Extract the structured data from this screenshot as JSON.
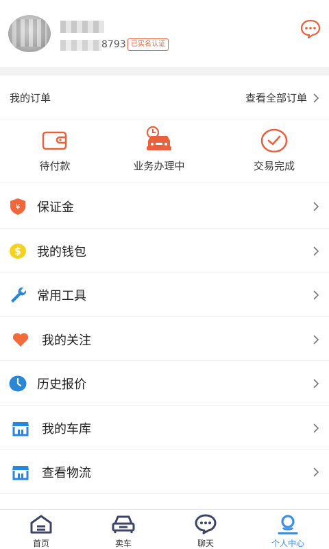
{
  "profile": {
    "phone_tail": "8793",
    "verified_badge": "已实名认证"
  },
  "orders": {
    "title": "我的订单",
    "view_all": "查看全部订单"
  },
  "order_status": [
    {
      "label": "待付款",
      "icon": "wallet-icon"
    },
    {
      "label": "业务办理中",
      "icon": "car-clock-icon"
    },
    {
      "label": "交易完成",
      "icon": "check-circle-icon"
    }
  ],
  "menu": [
    {
      "label": "保证金",
      "icon": "shield-yen-icon"
    },
    {
      "label": "我的钱包",
      "icon": "dollar-coin-icon"
    },
    {
      "label": "常用工具",
      "icon": "wrench-icon"
    },
    {
      "label": "我的关注",
      "icon": "heart-icon"
    },
    {
      "label": "历史报价",
      "icon": "clock-icon"
    },
    {
      "label": "我的车库",
      "icon": "store-icon"
    },
    {
      "label": "查看物流",
      "icon": "store-icon"
    }
  ],
  "tabs": [
    {
      "label": "首页",
      "icon": "home-icon",
      "active": false
    },
    {
      "label": "卖车",
      "icon": "car-icon",
      "active": false
    },
    {
      "label": "聊天",
      "icon": "chat-icon",
      "active": false
    },
    {
      "label": "个人中心",
      "icon": "person-icon",
      "active": true
    }
  ],
  "colors": {
    "accent_orange": "#e8603c",
    "active_blue": "#3b8ee8",
    "coin_yellow": "#f5d21c",
    "wrench_blue": "#2a86d6",
    "heart_orange": "#f26b3a",
    "clock_blue": "#2a86d6",
    "tab_dark": "#3d4466"
  }
}
